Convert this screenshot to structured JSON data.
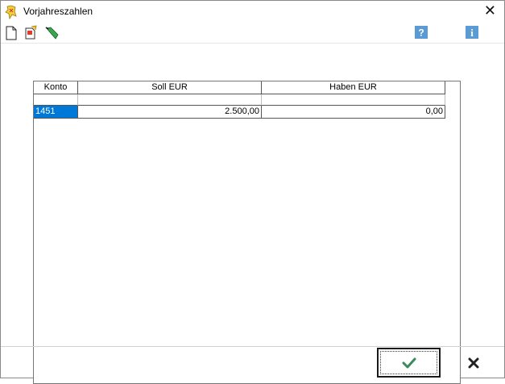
{
  "window": {
    "title": "Vorjahreszahlen",
    "close_symbol": "✕"
  },
  "toolbar": {
    "buttons": [
      {
        "name": "new-document-icon"
      },
      {
        "name": "edit-document-icon"
      },
      {
        "name": "green-pen-icon"
      }
    ],
    "help_symbol": "?",
    "info_symbol": "i"
  },
  "grid": {
    "columns": [
      "Konto",
      "Soll EUR",
      "Haben EUR"
    ],
    "rows": [
      {
        "konto": "1451",
        "soll": "2.500,00",
        "haben": "0,00"
      }
    ]
  },
  "colors": {
    "selection": "#0078d7",
    "ok_check": "#3a8a5c",
    "help_icon_bg": "#5b9bd5"
  }
}
